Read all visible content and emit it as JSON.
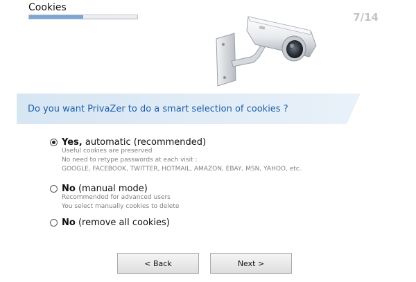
{
  "header": {
    "title": "Cookies",
    "step": "7/14",
    "progress": 0.5
  },
  "question": "Do you want PrivaZer to do a smart selection of cookies ?",
  "options": [
    {
      "bold": "Yes,",
      "rest": " automatic (recommended)",
      "selected": true,
      "desc": [
        "Useful cookies are preserved",
        "No need to retype passwords at each visit :",
        "GOOGLE, FACEBOOK, TWITTER, HOTMAIL, AMAZON, EBAY, MSN, YAHOO, etc."
      ]
    },
    {
      "bold": "No",
      "rest": " (manual mode)",
      "selected": false,
      "desc": [
        "Recommended for advanced users",
        "You select manually cookies to delete"
      ]
    },
    {
      "bold": "No",
      "rest": " (remove all cookies)",
      "selected": false,
      "desc": []
    }
  ],
  "buttons": {
    "back": "< Back",
    "next": "Next >"
  },
  "colors": {
    "question_text": "#1c5fa8",
    "question_band": "#dbe8f4",
    "progress_fill": "#7aa7d6"
  }
}
